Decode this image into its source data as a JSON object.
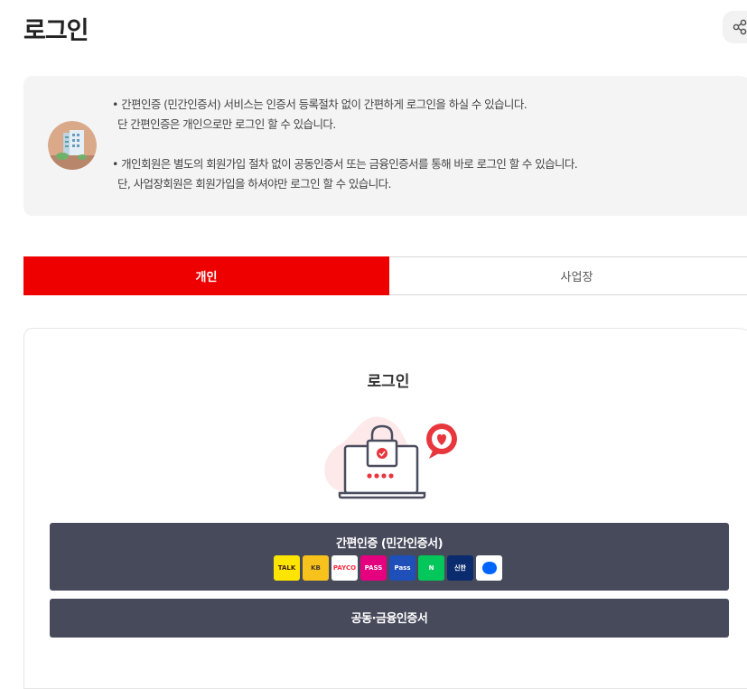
{
  "header": {
    "title": "로그인",
    "share_icon": "share-icon"
  },
  "notice": {
    "icon": "building-icon",
    "lines": [
      "• 간편인증 (민간인증서) 서비스는 인증서 등록절차 없이 간편하게 로그인을 하실 수 있습니다.",
      "단 간편인증은 개인으로만 로그인 할 수 있습니다.",
      "• 개인회원은 별도의 회원가입 절차 없이 공동인증서 또는 금융인증서를 통해 바로 로그인 할 수 있습니다.",
      "단, 사업장회원은 회원가입을 하셔야만 로그인 할 수 있습니다."
    ]
  },
  "tabs": [
    {
      "label": "개인",
      "active": true
    },
    {
      "label": "사업장",
      "active": false
    }
  ],
  "login": {
    "title": "로그인",
    "illustration": "laptop-lock-icon",
    "simple_auth_label": "간편인증 (민간인증서)",
    "providers": [
      {
        "name": "kakao-icon",
        "text": "TALK",
        "bg": "#fee500",
        "fg": "#3c1e1e"
      },
      {
        "name": "kb-icon",
        "text": "KB",
        "bg": "#f7c21b",
        "fg": "#4a3b2a"
      },
      {
        "name": "payco-icon",
        "text": "PAYCO",
        "bg": "#ffffff",
        "fg": "#ff2b3d"
      },
      {
        "name": "pass-icon",
        "text": "PASS",
        "bg": "#e5007f",
        "fg": "#ffffff"
      },
      {
        "name": "samsung-pass-icon",
        "text": "Pass",
        "bg": "#1f4fb8",
        "fg": "#ffffff"
      },
      {
        "name": "naver-icon",
        "text": "N",
        "bg": "#03c75a",
        "fg": "#ffffff"
      },
      {
        "name": "shinhan-icon",
        "text": "신한",
        "bg": "#0a2b6e",
        "fg": "#ffffff"
      },
      {
        "name": "toss-icon",
        "text": "",
        "bg": "#ffffff",
        "fg": "#0064ff"
      }
    ],
    "cert_label": "공동·금융인증서"
  },
  "colors": {
    "accent": "#ee0000",
    "button_dark": "#474a5b",
    "notice_bg": "#f4f4f4"
  }
}
